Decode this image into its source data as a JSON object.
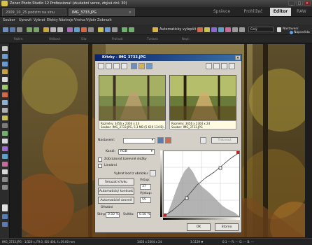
{
  "app": {
    "title": "Zoner Photo Studio 12 Professional (zkušební verze, zbývá dní: 30)",
    "window_buttons": [
      "_",
      "□",
      "×"
    ]
  },
  "tabs": {
    "files": [
      "2009_10_25 podzim na sinu",
      "IMG_3733.JPG"
    ],
    "modes": [
      "Správce",
      "Prohlížeč",
      "Editor",
      "RAW"
    ],
    "active_mode": "Editor"
  },
  "menu": [
    "Soubor",
    "Upravit",
    "Vybrat",
    "Efekty",
    "Nástroje",
    "Vrstva",
    "Výběr",
    "Zobrazit"
  ],
  "toolbar": {
    "auto_label": "Automaticky vylepšit",
    "zoom_label": "Celý",
    "settings_label": "Nastavení",
    "help_label": "Nápověda"
  },
  "options": {
    "items": [
      "Režim:",
      "Velikost:",
      "Síla:",
      "Prolnutí:",
      "Tvrdost:",
      "Nepř.:"
    ]
  },
  "dialog": {
    "title": "Křivky - IMG_3733.JPG",
    "info_left": [
      "Rozměry: 3456 x 2304 x 24",
      "Soubor: IMG_3733.JPG, 5.3 MB (5 619 134 B)..."
    ],
    "info_right": [
      "Rozměry: 3456 x 2304 x 24",
      "Soubor: IMG_3733.JPG"
    ],
    "preset_label": "Nastavení:",
    "preset_value": "",
    "channel_label": "Kanál:",
    "channel_value": "RGB",
    "check_color": "Zobrazovat barevné složky",
    "check_linear": "Lineární",
    "pick_label": "Vybrat bod z obrázku:",
    "btn_reset": "Smazat křivku",
    "btn_auto_contrast": "Automatický kontrast",
    "btn_auto_levels": "Automatické úrovně",
    "input_label": "Vstup:",
    "input_value": "37",
    "output_label": "Výstup:",
    "output_value": "55",
    "clip_label": "Ořezání",
    "shadows_label": "Stíny:",
    "shadows_value": "0.50 %",
    "highlights_label": "Světla:",
    "highlights_value": "0.50 %",
    "btn_print_label": "Tisknout",
    "ok": "OK",
    "cancel": "Storno"
  },
  "status": {
    "left": "IMG_3733.JPG - 1/320 s, F9.0, ISO 400, f=19.00 mm",
    "center": "3456 x 2304 x 24",
    "zoom": "3:1139 ▼",
    "right": "0:1 ---   R: ---   G: ---   B: ---"
  },
  "colors": {
    "accent": "#0a246a",
    "active_mode_bg": "#d9d9d9",
    "dialog_bg": "#d4d0c8"
  }
}
